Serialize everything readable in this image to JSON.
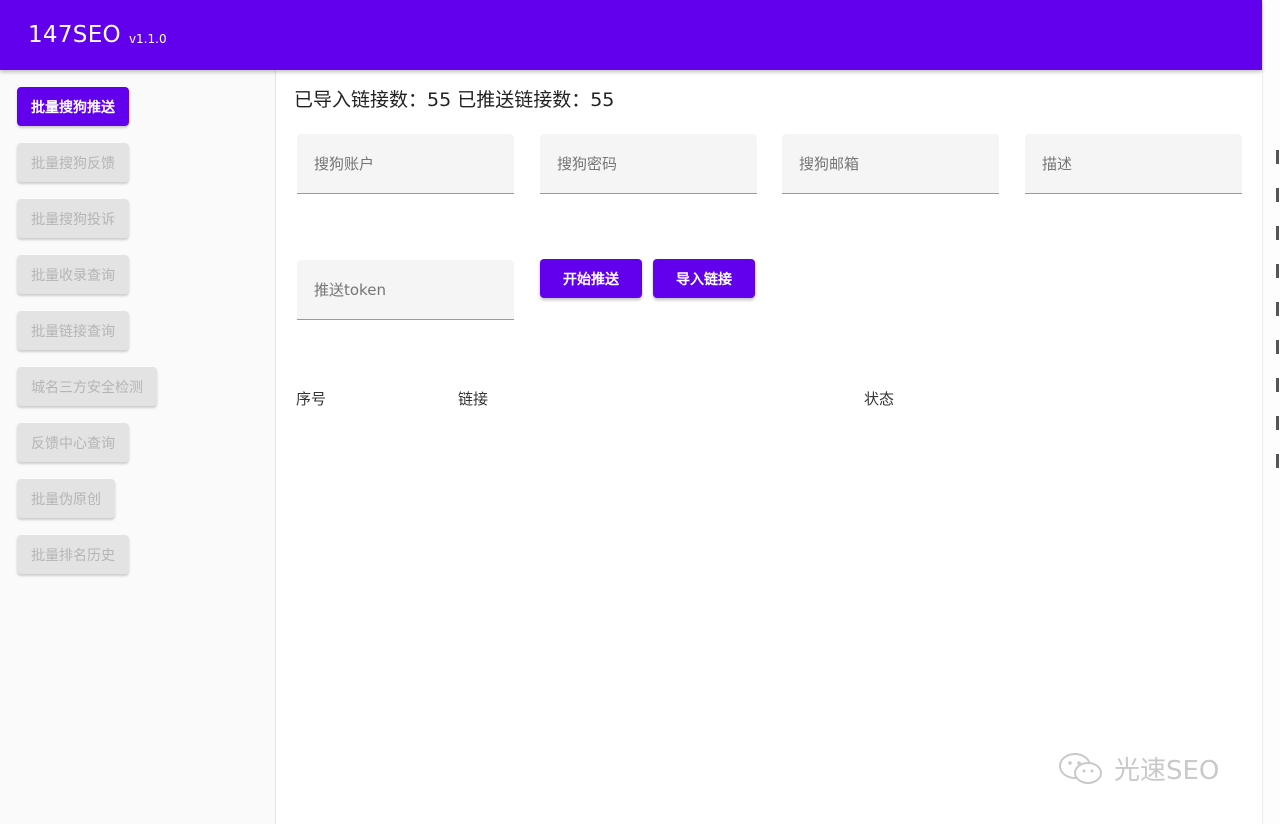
{
  "header": {
    "title": "147SEO",
    "version": "v1.1.0"
  },
  "sidebar": {
    "items": [
      {
        "label": "批量搜狗推送",
        "active": true
      },
      {
        "label": "批量搜狗反馈",
        "active": false
      },
      {
        "label": "批量搜狗投诉",
        "active": false
      },
      {
        "label": "批量收录查询",
        "active": false
      },
      {
        "label": "批量链接查询",
        "active": false
      },
      {
        "label": "城名三方安全检测",
        "active": false
      },
      {
        "label": "反馈中心查询",
        "active": false
      },
      {
        "label": "批量伪原创",
        "active": false
      },
      {
        "label": "批量排名历史",
        "active": false
      }
    ]
  },
  "main": {
    "stats": "已导入链接数：55 已推送链接数：55",
    "fields": {
      "account": {
        "placeholder": "搜狗账户",
        "value": ""
      },
      "password": {
        "placeholder": "搜狗密码",
        "value": ""
      },
      "email": {
        "placeholder": "搜狗邮箱",
        "value": ""
      },
      "description": {
        "placeholder": "描述",
        "value": ""
      },
      "token": {
        "placeholder": "推送token",
        "value": ""
      }
    },
    "buttons": {
      "start": "开始推送",
      "import": "导入链接"
    },
    "table": {
      "headers": [
        "序号",
        "链接",
        "状态"
      ],
      "rows": []
    }
  },
  "watermark": {
    "text": "光速SEO",
    "icon": "wechat-icon"
  },
  "colors": {
    "primary": "#6200ee",
    "disabled_bg": "#e3e3e3",
    "disabled_text": "#b5b5b5"
  }
}
